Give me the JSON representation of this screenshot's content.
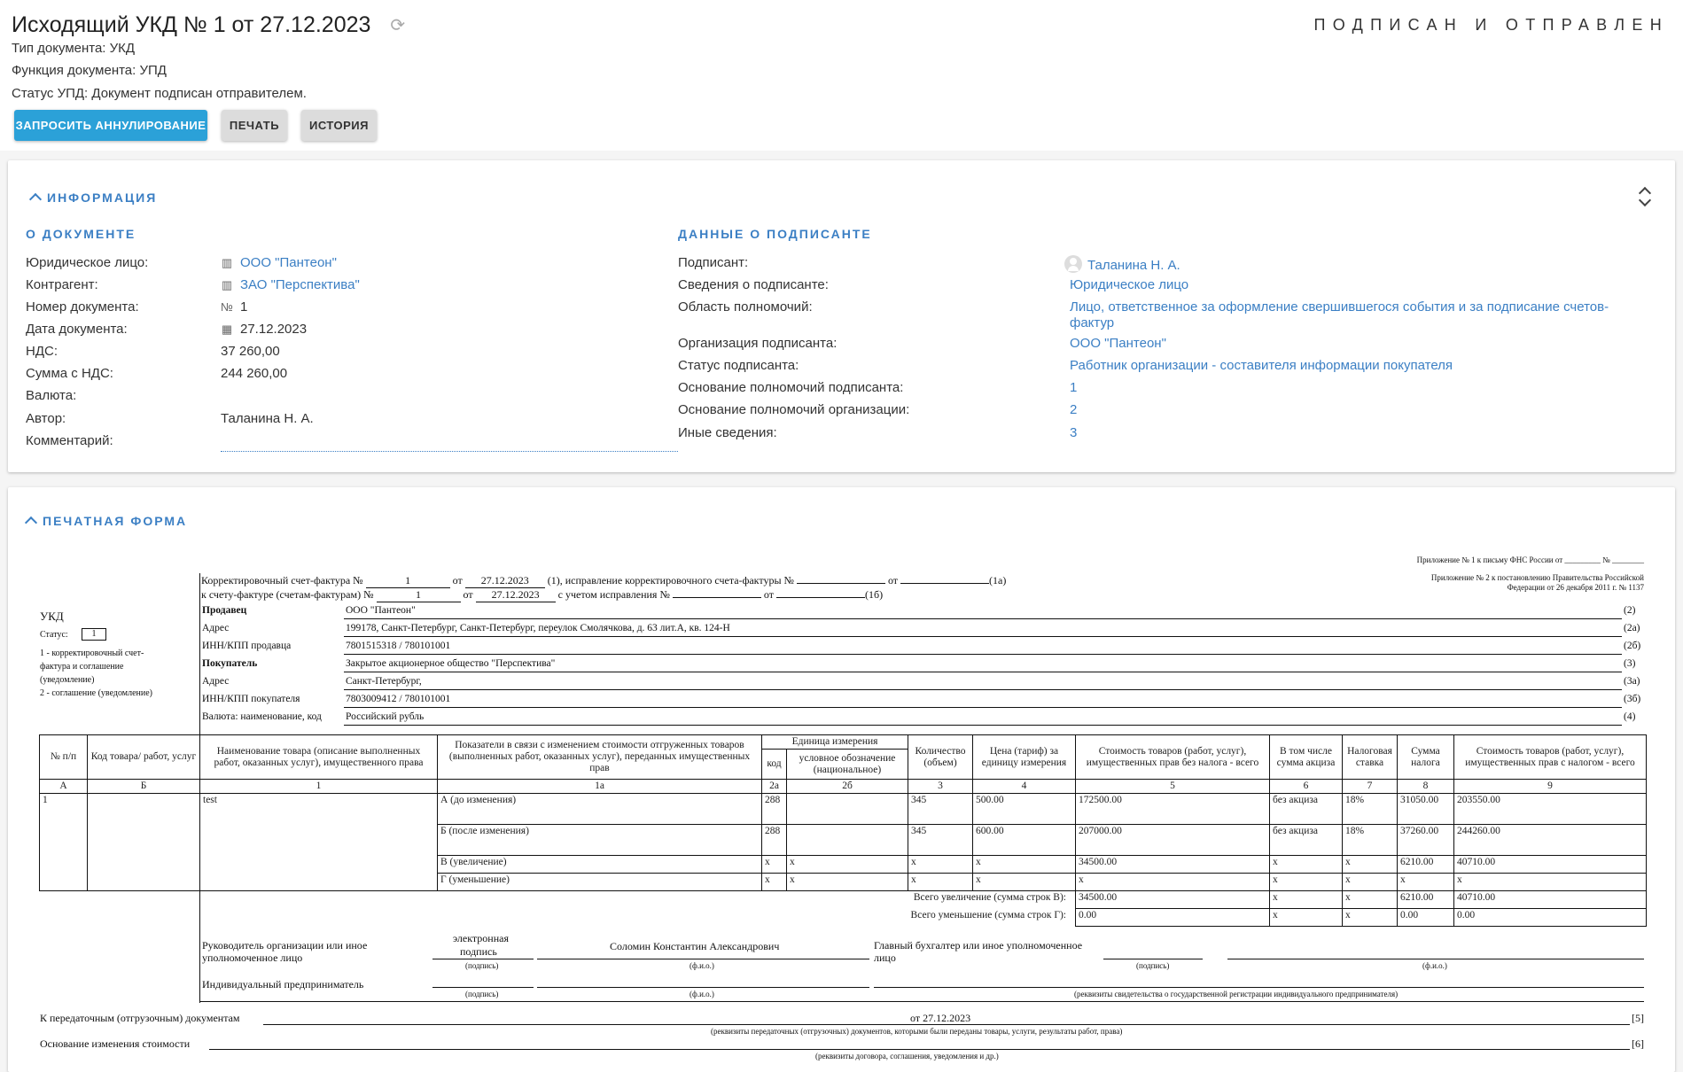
{
  "header": {
    "title": "Исходящий УКД № 1 от 27.12.2023",
    "status": "ПОДПИСАН И ОТПРАВЛЕН",
    "doc_type": "Тип документа: УКД",
    "doc_function": "Функция документа: УПД",
    "upd_status": "Статус УПД: Документ подписан отправителем.",
    "buttons": {
      "cancel_request": "ЗАПРОСИТЬ АННУЛИРОВАНИЕ",
      "print": "ПЕЧАТЬ",
      "history": "ИСТОРИЯ"
    }
  },
  "info": {
    "title": "ИНФОРМАЦИЯ",
    "about_doc": {
      "title": "О ДОКУМЕНТЕ",
      "rows": [
        {
          "label": "Юридическое лицо:",
          "value": "ООО \"Пантеон\"",
          "icon": "building-icon"
        },
        {
          "label": "Контрагент:",
          "value": "ЗАО \"Перспектива\"",
          "icon": "building-icon"
        },
        {
          "label": "Номер документа:",
          "value": "1",
          "icon": "number-icon"
        },
        {
          "label": "Дата документа:",
          "value": "27.12.2023",
          "icon": "calendar-icon"
        },
        {
          "label": "НДС:",
          "value": "37 260,00"
        },
        {
          "label": "Сумма с НДС:",
          "value": "244 260,00"
        },
        {
          "label": "Валюта:",
          "value": ""
        },
        {
          "label": "Автор:",
          "value": "Таланина Н. А."
        },
        {
          "label": "Комментарий:",
          "value": ""
        }
      ]
    },
    "signer": {
      "title": "ДАННЫЕ О ПОДПИСАНТЕ",
      "rows": [
        {
          "label": "Подписант:",
          "value": "Таланина Н. А."
        },
        {
          "label": "Сведения о подписанте:",
          "value": "Юридическое лицо"
        },
        {
          "label": "Область полномочий:",
          "value": "Лицо, ответственное за оформление свершившегося события и за подписание счетов-",
          "value2": "фактур"
        },
        {
          "label": "Организация подписанта:",
          "value": "ООО \"Пантеон\""
        },
        {
          "label": "Статус подписанта:",
          "value": "Работник организации - составителя информации покупателя"
        },
        {
          "label": "Основание полномочий подписанта:",
          "value": "1"
        },
        {
          "label": "Основание полномочий организации:",
          "value": "2"
        },
        {
          "label": "Иные сведения:",
          "value": "3"
        }
      ]
    }
  },
  "print_form": {
    "title": "ПЕЧАТНАЯ ФОРМА",
    "appendix1": "Приложение № 1 к письму ФНС России от _________ № ________",
    "appendix2a": "Приложение № 2 к постановлению Правительства Российской",
    "appendix2b": "Федерации от 26 декабря 2011 г. № 1137",
    "line1": {
      "a": "Корректировочный счет-фактура №",
      "num": "1",
      "ot": "от",
      "date": "27.12.2023",
      "b": "(1), исправление корректировочного счета-фактуры №",
      "ot2": "от",
      "c": "(1а)"
    },
    "line2": {
      "a": "к счету-фактуре (счетам-фактурам) №",
      "num": "1",
      "ot": "от",
      "date": "27.12.2023",
      "b": "с учетом исправления №",
      "ot2": "от",
      "c": "(1б)"
    },
    "ukd": "УКД",
    "status_label": "Статус:",
    "status_value": "1",
    "status_note1": "1 - корректировочный счет-",
    "status_note2": "фактура и соглашение",
    "status_note3": "(уведомление)",
    "status_note4": "2 - соглашение (уведомление)",
    "parties": [
      {
        "label": "Продавец",
        "value": "ООО \"Пантеон\"",
        "code": "(2)",
        "bold": true
      },
      {
        "label": "Адрес",
        "value": "199178, Санкт-Петербург, Санкт-Петербург, переулок Смолячкова, д. 63 лит.А, кв. 124-Н",
        "code": "(2а)"
      },
      {
        "label": "ИНН/КПП продавца",
        "value": "7801515318 / 780101001",
        "code": "(2б)"
      },
      {
        "label": "Покупатель",
        "value": "Закрытое акционерное общество \"Перспектива\"",
        "code": "(3)",
        "bold": true
      },
      {
        "label": "Адрес",
        "value": "Санкт-Петербург,",
        "code": "(3а)"
      },
      {
        "label": "ИНН/КПП покупателя",
        "value": "7803009412 / 780101001",
        "code": "(3б)"
      },
      {
        "label": "Валюта: наименование, код",
        "value": "Российский рубль",
        "code": "(4)"
      }
    ],
    "table": {
      "headers": {
        "npp": "№ п/п",
        "code": "Код товара/ работ, услуг",
        "name": "Наименование товара (описание выполненных работ, оказанных услуг), имущественного права",
        "indicators": "Показатели в связи с изменением стоимости отгруженных товаров (выполненных работ, оказанных услуг), переданных имущественных прав",
        "unit": "Единица измерения",
        "unit_code": "код",
        "unit_name": "условное обозначение (национальное)",
        "qty": "Количество (объем)",
        "price": "Цена (тариф) за единицу измерения",
        "cost": "Стоимость товаров (работ, услуг), имущественных прав без налога - всего",
        "excise": "В том числе сумма акциза",
        "rate": "Налоговая ставка",
        "tax": "Сумма налога",
        "total": "Стоимость товаров (работ, услуг), имущественных прав с налогом - всего"
      },
      "col_nums": [
        "А",
        "Б",
        "1",
        "1а",
        "2а",
        "2б",
        "3",
        "4",
        "5",
        "6",
        "7",
        "8",
        "9"
      ],
      "item": {
        "npp": "1",
        "code": "",
        "name": "test"
      },
      "rows": [
        {
          "label": "А (до изменения)",
          "unit_code": "288",
          "unit_name": "",
          "qty": "345",
          "price": "500.00",
          "cost": "172500.00",
          "excise": "без акциза",
          "rate": "18%",
          "tax": "31050.00",
          "total": "203550.00"
        },
        {
          "label": "Б (после изменения)",
          "unit_code": "288",
          "unit_name": "",
          "qty": "345",
          "price": "600.00",
          "cost": "207000.00",
          "excise": "без акциза",
          "rate": "18%",
          "tax": "37260.00",
          "total": "244260.00"
        },
        {
          "label": "В (увеличение)",
          "unit_code": "x",
          "unit_name": "x",
          "qty": "x",
          "price": "x",
          "cost": "34500.00",
          "excise": "x",
          "rate": "x",
          "tax": "6210.00",
          "total": "40710.00"
        },
        {
          "label": "Г (уменьшение)",
          "unit_code": "x",
          "unit_name": "x",
          "qty": "x",
          "price": "x",
          "cost": "x",
          "excise": "x",
          "rate": "x",
          "tax": "x",
          "total": "x"
        }
      ],
      "total_inc": {
        "label": "Всего увеличение (сумма строк В):",
        "cost": "34500.00",
        "excise": "x",
        "rate": "x",
        "tax": "6210.00",
        "total": "40710.00"
      },
      "total_dec": {
        "label": "Всего уменьшение (сумма строк Г):",
        "cost": "0.00",
        "excise": "x",
        "rate": "x",
        "tax": "0.00",
        "total": "0.00"
      }
    },
    "signatures": {
      "head_a": "Руководитель организации или иное",
      "head_b": "уполномоченное лицо",
      "e_sign_a": "электронная",
      "e_sign_b": "подпись",
      "head_name": "Соломин Константин Александрович",
      "accountant_a": "Главный бухгалтер или иное уполномоченное",
      "accountant_b": "лицо",
      "sign_caption": "(подпись)",
      "fio_caption": "(ф.и.о.)",
      "ip": "Индивидуальный предприниматель",
      "ip_caption": "(реквизиты свидетельства о государственной регистрации индивидуального предпринимателя)"
    },
    "transfer": {
      "label": "К передаточным (отгрузочным) документам",
      "value": "от 27.12.2023",
      "code": "[5]",
      "caption": "(реквизиты передаточных (отгрузочных) документов, которыми были переданы товары, услуги, результаты работ, права)"
    },
    "basis": {
      "label": "Основание изменения стоимости",
      "code": "[6]",
      "caption": "(реквизиты договора, соглашения, уведомления и др.)"
    }
  }
}
